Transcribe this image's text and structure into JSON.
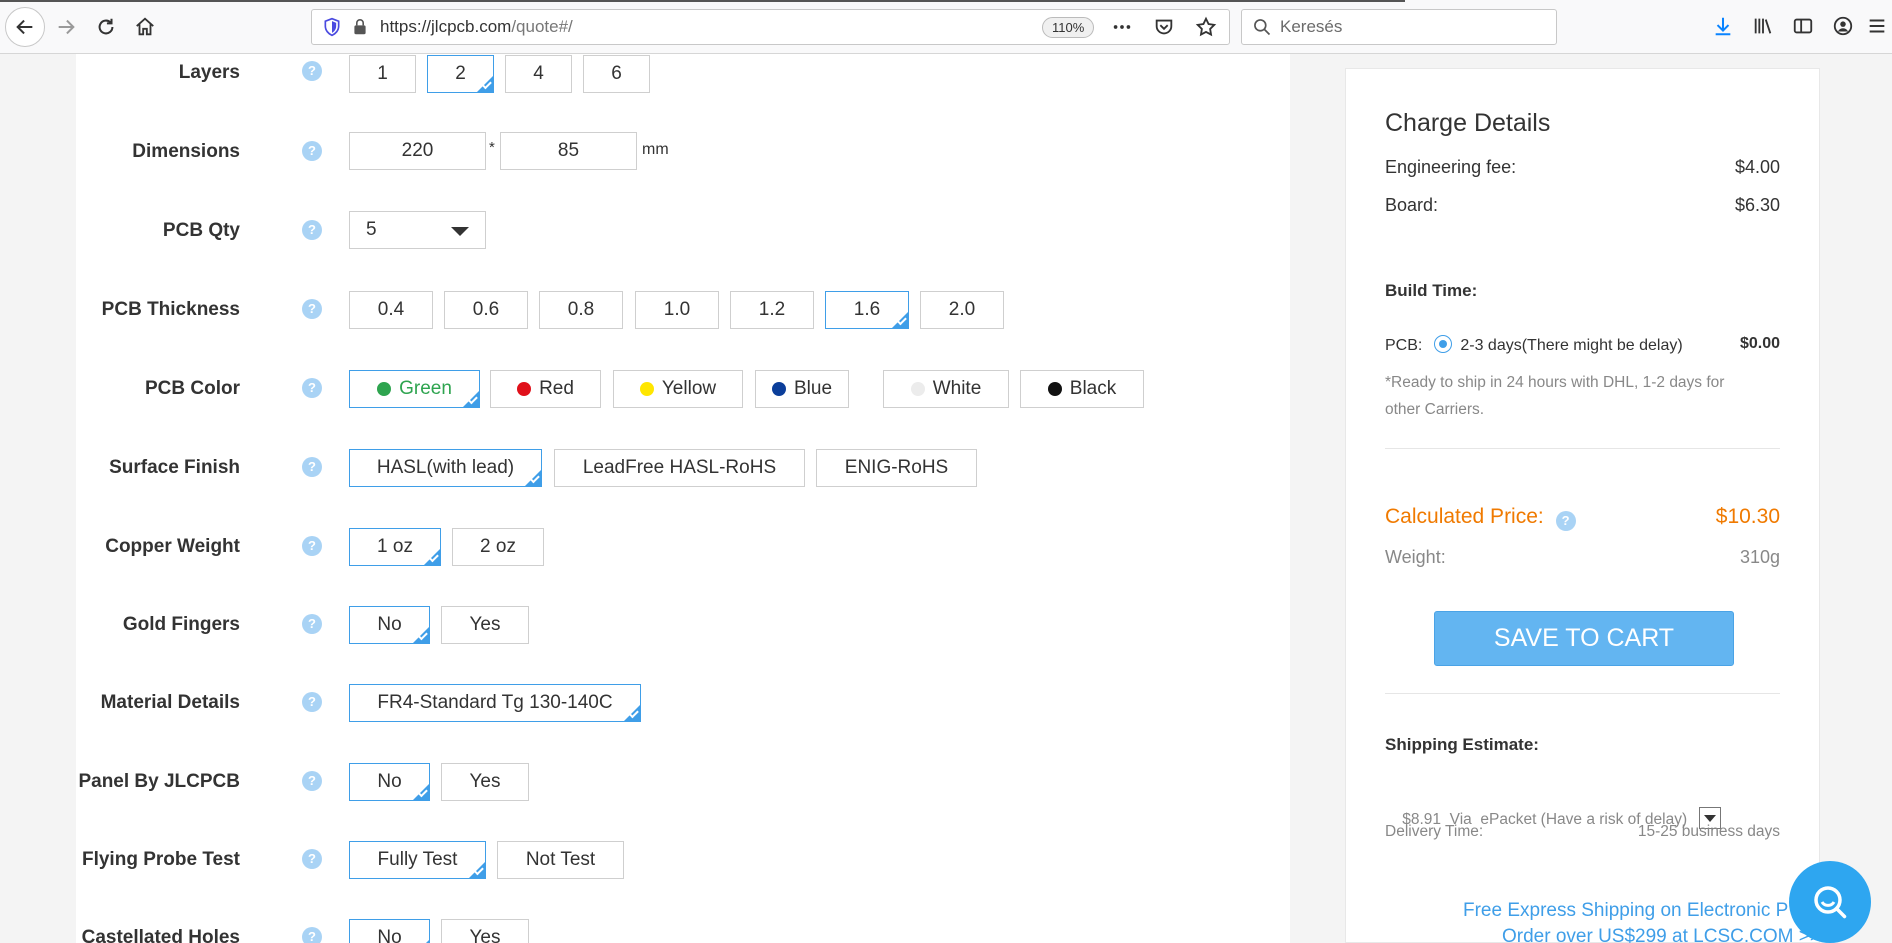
{
  "browser": {
    "url_host": "https://jlcpcb.com",
    "url_path": "/quote#/",
    "zoom": "110%",
    "search_placeholder": "Keresés"
  },
  "form": {
    "layers": {
      "label": "Layers",
      "options": [
        "1",
        "2",
        "4",
        "6"
      ],
      "selected": "2"
    },
    "dimensions": {
      "label": "Dimensions",
      "width": "220",
      "height": "85",
      "separator": "*",
      "unit": "mm"
    },
    "pcb_qty": {
      "label": "PCB Qty",
      "value": "5"
    },
    "thickness": {
      "label": "PCB Thickness",
      "options": [
        "0.4",
        "0.6",
        "0.8",
        "1.0",
        "1.2",
        "1.6",
        "2.0"
      ],
      "selected": "1.6"
    },
    "color": {
      "label": "PCB Color",
      "options": [
        {
          "name": "Green",
          "hex": "#2ea44f"
        },
        {
          "name": "Red",
          "hex": "#e0101a"
        },
        {
          "name": "Yellow",
          "hex": "#ffe600"
        },
        {
          "name": "Blue",
          "hex": "#0b3e9a"
        },
        {
          "name": "White",
          "hex": "#ececec"
        },
        {
          "name": "Black",
          "hex": "#111111"
        }
      ],
      "selected": "Green"
    },
    "surface_finish": {
      "label": "Surface Finish",
      "options": [
        "HASL(with lead)",
        "LeadFree HASL-RoHS",
        "ENIG-RoHS"
      ],
      "selected": "HASL(with lead)"
    },
    "copper_weight": {
      "label": "Copper Weight",
      "options": [
        "1 oz",
        "2 oz"
      ],
      "selected": "1 oz"
    },
    "gold_fingers": {
      "label": "Gold Fingers",
      "options": [
        "No",
        "Yes"
      ],
      "selected": "No"
    },
    "material": {
      "label": "Material Details",
      "options": [
        "FR4-Standard Tg 130-140C"
      ],
      "selected": "FR4-Standard Tg 130-140C"
    },
    "panel": {
      "label": "Panel By JLCPCB",
      "options": [
        "No",
        "Yes"
      ],
      "selected": "No"
    },
    "flying_probe": {
      "label": "Flying Probe Test",
      "options": [
        "Fully Test",
        "Not Test"
      ],
      "selected": "Fully Test"
    },
    "castellated": {
      "label": "Castellated Holes",
      "options": [
        "No",
        "Yes"
      ],
      "selected": "No"
    }
  },
  "charge": {
    "title": "Charge Details",
    "engineering_fee_label": "Engineering fee:",
    "engineering_fee": "$4.00",
    "board_label": "Board:",
    "board": "$6.30",
    "build_time_label": "Build Time:",
    "pcb_label": "PCB:",
    "build_option": "2-3 days(There might be delay)",
    "build_price": "$0.00",
    "ship_note_1": "*Ready to ship in 24 hours with DHL, 1-2 days for",
    "ship_note_2": "other Carriers.",
    "calc_price_label": "Calculated Price:",
    "calc_price": "$10.30",
    "weight_label": "Weight:",
    "weight": "310g",
    "save_button": "SAVE TO CART",
    "shipping_label": "Shipping Estimate:",
    "shipping_text": "$8.91  Via  ePacket (Have a risk of delay)",
    "delivery_label": "Delivery Time:",
    "delivery_value": "15-25 business days",
    "promo_line1": "Free Express Shipping on Electronic P",
    "promo_line2": "Order over US$299 at LCSC.COM >>"
  },
  "colors": {
    "accent": "#3f9ee8",
    "price": "#f07a00",
    "button": "#63b5f1"
  }
}
